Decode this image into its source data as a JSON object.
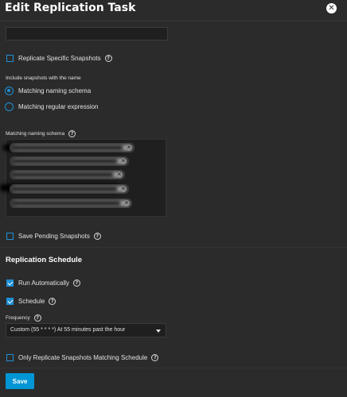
{
  "dialog": {
    "title": "Edit Replication Task",
    "close_icon": "close-icon"
  },
  "replicate_specific_snapshots": {
    "label": "Replicate Specific Snapshots",
    "checked": false,
    "help_icon": "?"
  },
  "include_snapshots": {
    "label": "Include snapshots with the name",
    "options": [
      {
        "label": "Matching naming schema",
        "selected": true
      },
      {
        "label": "Matching regular expression",
        "selected": false
      }
    ]
  },
  "naming_schema": {
    "label": "Matching naming schema",
    "help_icon": "?",
    "chip_remove_glyph": "×"
  },
  "save_pending_snapshots": {
    "label": "Save Pending Snapshots",
    "checked": false,
    "help_icon": "?"
  },
  "replication_schedule": {
    "heading": "Replication Schedule",
    "run_automatically": {
      "label": "Run Automatically",
      "checked": true,
      "help_icon": "?"
    },
    "schedule": {
      "label": "Schedule",
      "checked": true,
      "help_icon": "?"
    },
    "frequency": {
      "label": "Frequency",
      "help_icon": "?",
      "value": "Custom (55 * * * *) At 55 minutes past the hour"
    },
    "only_matching": {
      "label": "Only Replicate Snapshots Matching Schedule",
      "checked": false,
      "help_icon": "?"
    }
  },
  "actions": {
    "save_label": "Save"
  },
  "colors": {
    "accent": "#1e90d6",
    "button": "#0095d5",
    "background": "#2b2b2b"
  }
}
